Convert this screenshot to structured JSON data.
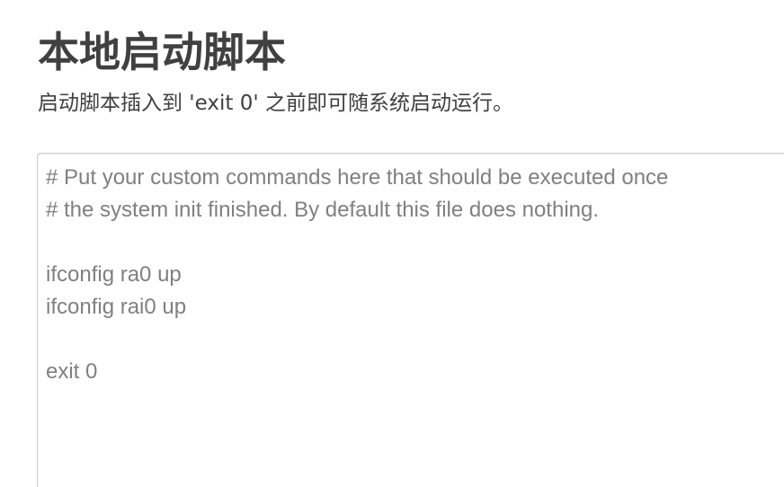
{
  "page": {
    "title": "本地启动脚本",
    "description": "启动脚本插入到 'exit 0' 之前即可随系统启动运行。"
  },
  "script_editor": {
    "content": "# Put your custom commands here that should be executed once\n# the system init finished. By default this file does nothing.\n\nifconfig ra0 up\nifconfig rai0 up\n\nexit 0\n"
  }
}
